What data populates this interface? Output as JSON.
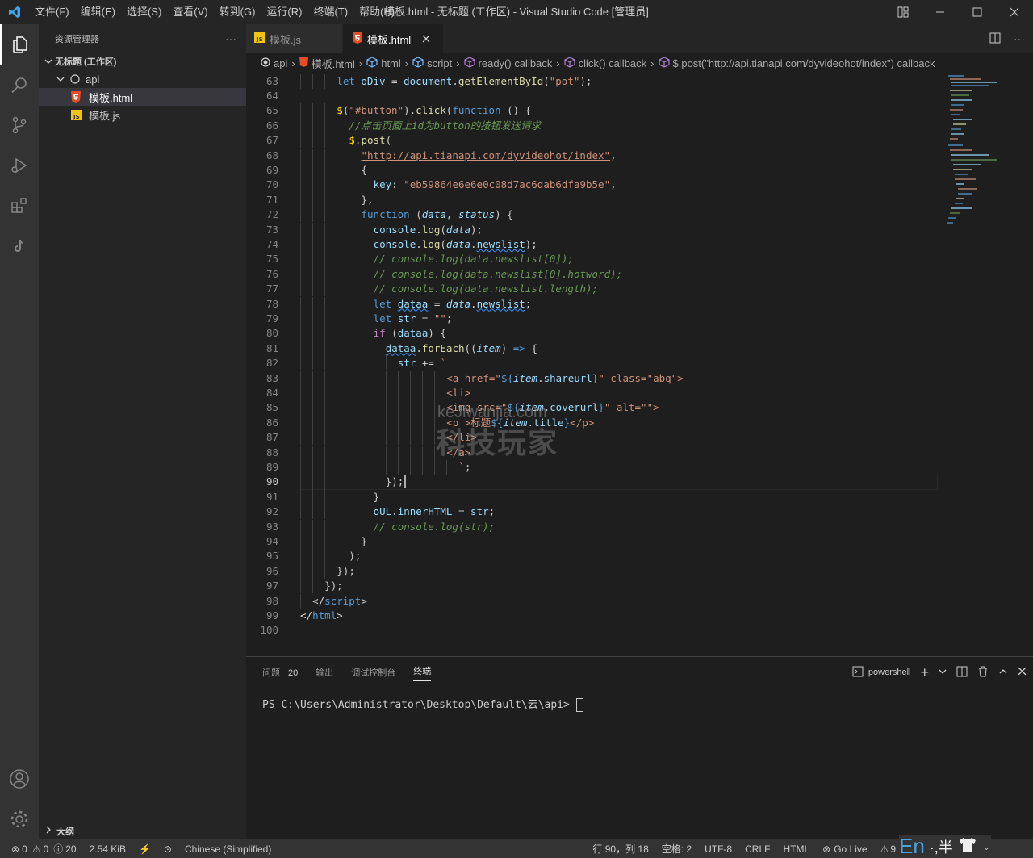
{
  "titlebar": {
    "menu": [
      "文件(F)",
      "编辑(E)",
      "选择(S)",
      "查看(V)",
      "转到(G)",
      "运行(R)",
      "终端(T)",
      "帮助(H)"
    ],
    "window_title": "模板.html - 无标题 (工作区) - Visual Studio Code [管理员]"
  },
  "sidebar": {
    "title": "资源管理器",
    "workspace": "无标题 (工作区)",
    "folder": "api",
    "files": [
      "模板.html",
      "模板.js"
    ],
    "outline": "大纲"
  },
  "tabs": [
    {
      "label": "模板.js",
      "icon": "js-file-icon"
    },
    {
      "label": "模板.html",
      "icon": "html-file-icon"
    }
  ],
  "breadcrumb": [
    "api",
    "模板.html",
    "html",
    "script",
    "ready() callback",
    "click() callback",
    "$.post(\"http://api.tianapi.com/dyvideohot/index\") callback"
  ],
  "editor": {
    "current_line": 90,
    "watermark_top": "keJiwanjia.com",
    "watermark_bottom": "科技玩家"
  },
  "panel": {
    "tabs": [
      "问题",
      "输出",
      "调试控制台",
      "终端"
    ],
    "problems_count": "20",
    "active_tab": "终端",
    "terminal_name": "powershell",
    "prompt": "PS C:\\Users\\Administrator\\Desktop\\Default\\云\\api> "
  },
  "status": {
    "errors": "0",
    "warnings": "0",
    "infos": "20",
    "size": "2.54 KiB",
    "language_pack": "Chinese (Simplified)",
    "position": "行 90，列 18",
    "spaces": "空格: 2",
    "encoding": "UTF-8",
    "eol": "CRLF",
    "mode": "HTML",
    "golive": "Go Live",
    "warn_tail": "9",
    "ime": "En",
    "ime_mode": "·,半"
  }
}
